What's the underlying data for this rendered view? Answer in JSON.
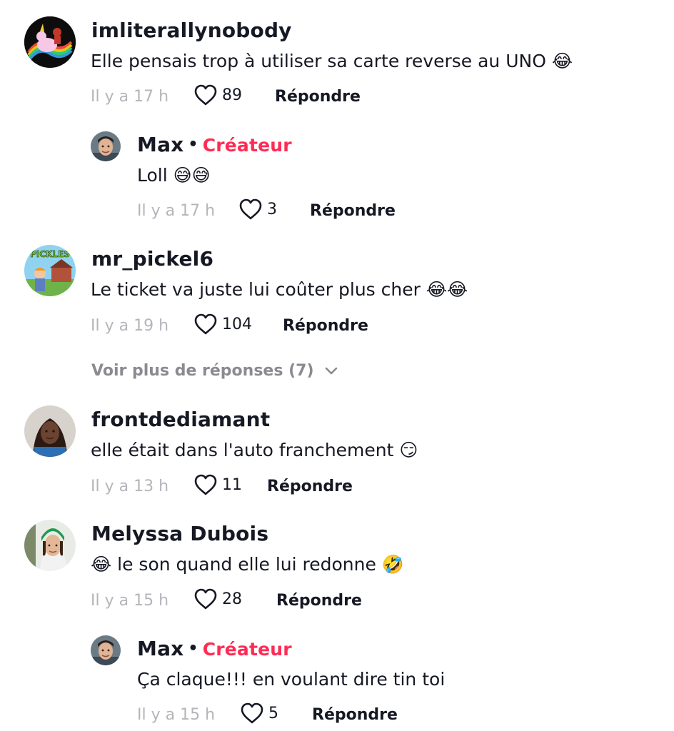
{
  "comments": [
    {
      "author": "imliterallynobody",
      "text": "Elle pensais trop à utiliser sa carte reverse au UNO 😂",
      "time": "Il y a 17 h",
      "likes": "89",
      "reply_label": "Répondre",
      "avatar_icon": "unicorn-avatar"
    },
    {
      "author": "Max",
      "creator_label": "Créateur",
      "text": "Loll 😅😅",
      "time": "Il y a 17 h",
      "likes": "3",
      "reply_label": "Répondre",
      "avatar_icon": "man-avatar"
    },
    {
      "author": "mr_pickel6",
      "text": "Le ticket va juste lui coûter plus cher 😂😂",
      "time": "Il y a 19 h",
      "likes": "104",
      "reply_label": "Répondre",
      "avatar_icon": "pickles-avatar",
      "avatar_text": "PICKLES"
    },
    {
      "author": "frontdediamant",
      "text": "elle était dans l'auto franchement 😏",
      "time": "Il y a 13 h",
      "likes": "11",
      "reply_label": "Répondre",
      "avatar_icon": "woman-avatar"
    },
    {
      "author": "Melyssa Dubois",
      "text": "😂 le son quand elle lui redonne 🤣",
      "time": "Il y a 15 h",
      "likes": "28",
      "reply_label": "Répondre",
      "avatar_icon": "woman-green-hat-avatar"
    },
    {
      "author": "Max",
      "creator_label": "Créateur",
      "text": "Ça claque!!! en voulant dire tin toi",
      "time": "Il y a 15 h",
      "likes": "5",
      "reply_label": "Répondre",
      "avatar_icon": "man-avatar"
    }
  ],
  "view_more": {
    "label": "Voir plus de réponses (7)",
    "icon": "chevron-down-icon"
  },
  "colors": {
    "creator": "#fe2c55",
    "muted": "#b4b5ba",
    "text": "#161823",
    "view_more": "#8a8b91"
  }
}
